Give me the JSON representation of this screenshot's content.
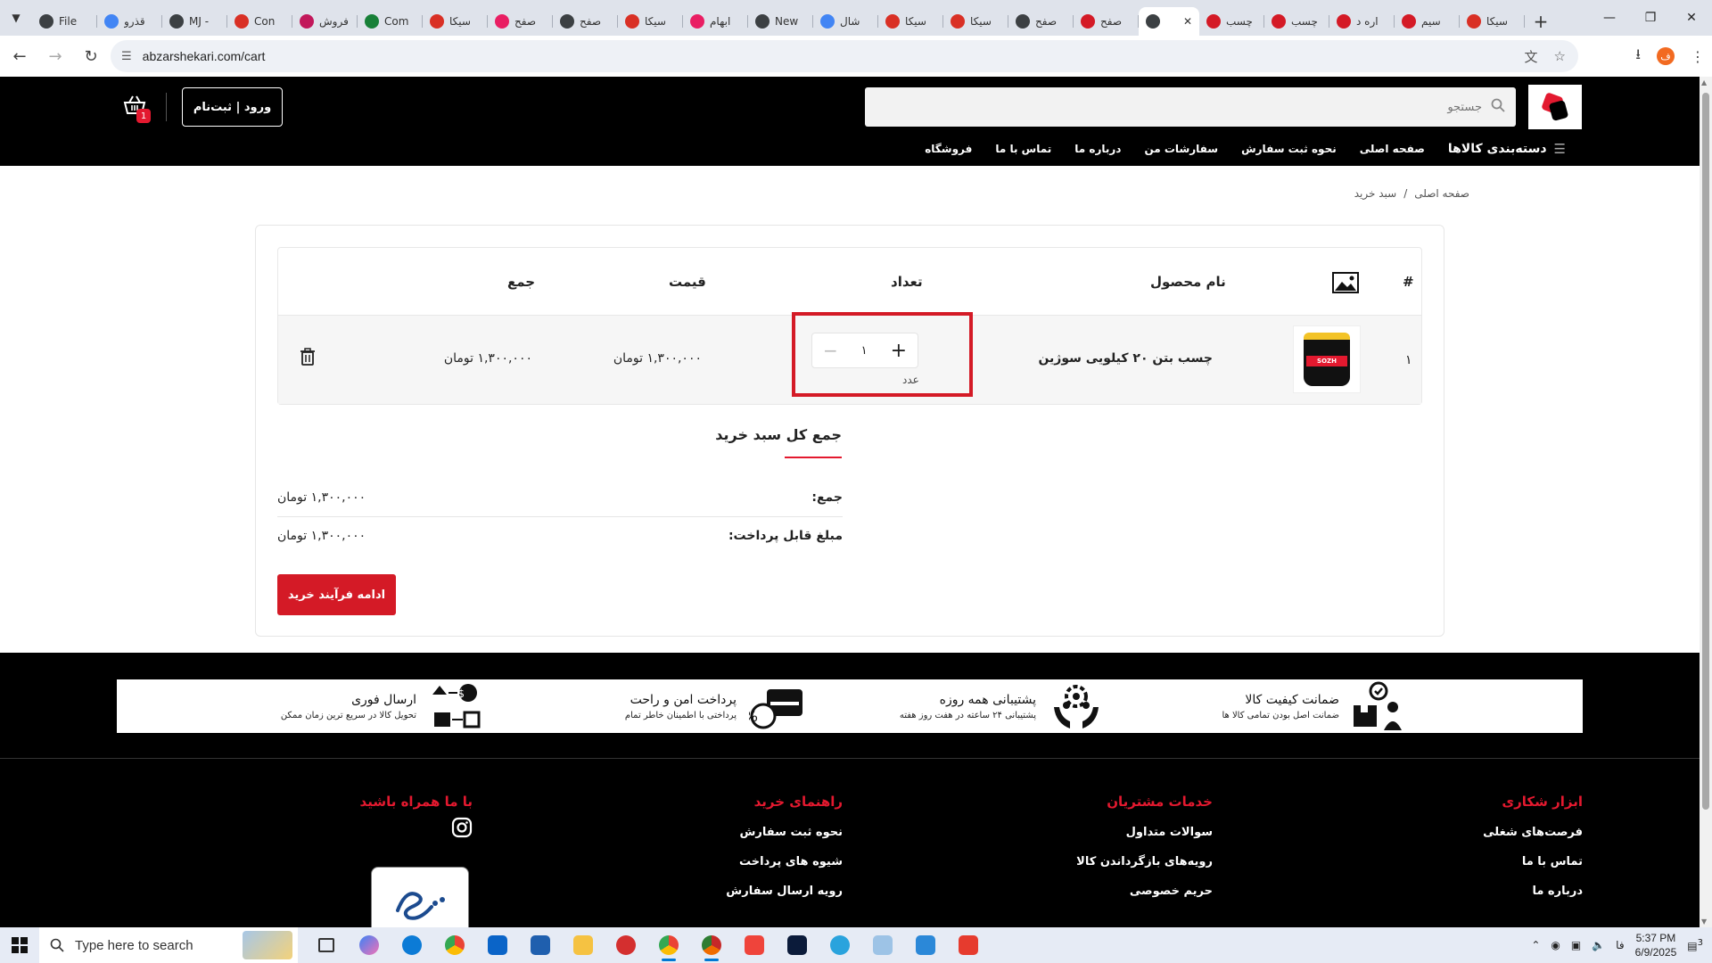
{
  "browser": {
    "tabs": [
      {
        "label": "File",
        "color": "#3c4043"
      },
      {
        "label": "قذرو",
        "color": "#4285f4"
      },
      {
        "label": "MJ -",
        "color": "#3c4043"
      },
      {
        "label": "Con",
        "color": "#d93025"
      },
      {
        "label": "فروش",
        "color": "#c2185b"
      },
      {
        "label": "Com",
        "color": "#188038"
      },
      {
        "label": "سیکا",
        "color": "#d93025"
      },
      {
        "label": "صفح",
        "color": "#e91e63"
      },
      {
        "label": "صفح",
        "color": "#3c4043"
      },
      {
        "label": "سیکا",
        "color": "#d93025"
      },
      {
        "label": "ابهام",
        "color": "#e91e63"
      },
      {
        "label": "New",
        "color": "#3c4043"
      },
      {
        "label": "شال",
        "color": "#4285f4"
      },
      {
        "label": "سیکا",
        "color": "#d93025"
      },
      {
        "label": "سیکا",
        "color": "#d93025"
      },
      {
        "label": "صفح",
        "color": "#3c4043"
      },
      {
        "label": "صفح",
        "color": "#d41a26"
      },
      {
        "label": "",
        "color": "#3c4043",
        "active": true
      },
      {
        "label": "چسب",
        "color": "#d41a26"
      },
      {
        "label": "چسب",
        "color": "#d41a26"
      },
      {
        "label": "اره د",
        "color": "#d41a26"
      },
      {
        "label": "سیم",
        "color": "#d41a26"
      },
      {
        "label": "سیکا",
        "color": "#d93025"
      }
    ],
    "url": "abzarshekari.com/cart",
    "profile_initial": "ف"
  },
  "header": {
    "search_placeholder": "جستجو",
    "login_label": "ورود | ثبت‌نام",
    "cart_count": "1",
    "menu": {
      "categories": "دسته‌بندی کالاها",
      "home": "صفحه اصلی",
      "how_to_order": "نحوه ثبت سفارش",
      "my_orders": "سفارشات من",
      "about": "درباره ما",
      "contact": "تماس با ما",
      "shop": "فروشگاه"
    }
  },
  "breadcrumb": {
    "home": "صفحه اصلی",
    "sep": "/",
    "current": "سبد خرید"
  },
  "cart": {
    "headers": {
      "index": "#",
      "product": "نام محصول",
      "qty": "تعداد",
      "price": "قیمت",
      "total": "جمع"
    },
    "rows": [
      {
        "index": "۱",
        "thumb_label": "SOZH",
        "name": "چسب بتن ۲۰ کیلویی سوژین",
        "qty": "۱",
        "unit": "عدد",
        "price": "۱,۳۰۰,۰۰۰ تومان",
        "total": "۱,۳۰۰,۰۰۰ تومان"
      }
    ]
  },
  "totals": {
    "title": "جمع کل سبد خرید",
    "subtotal_label": "جمع:",
    "subtotal_value": "۱,۳۰۰,۰۰۰ تومان",
    "payable_label": "مبلغ قابل پرداخت:",
    "payable_value": "۱,۳۰۰,۰۰۰ تومان",
    "checkout_label": "ادامه فرآیند خرید"
  },
  "features": [
    {
      "title": "ضمانت کیفیت کالا",
      "subtitle": "ضمانت اصل بودن تمامی کالا ها",
      "icon": "quality-box-icon"
    },
    {
      "title": "پشتیبانی همه روزه",
      "subtitle": "پشتیبانی ۲۴ ساعته در هفت روز هفته",
      "icon": "support-hands-icon"
    },
    {
      "title": "پرداخت امن و راحت",
      "subtitle": "پرداختی با اطمینان خاطر تمام",
      "icon": "secure-payment-icon"
    },
    {
      "title": "ارسال فوری",
      "subtitle": "تحویل کالا در سریع ترین زمان ممکن",
      "icon": "fast-delivery-icon"
    }
  ],
  "footer": {
    "col1": {
      "title": "ابزار شکاری",
      "links": [
        "فرصت‌های شغلی",
        "تماس با ما",
        "درباره ما"
      ]
    },
    "col2": {
      "title": "خدمات مشتریان",
      "links": [
        "سوالات متداول",
        "رویه‌های بازگرداندن کالا",
        "حریم خصوصی"
      ]
    },
    "col3": {
      "title": "راهنمای خرید",
      "links": [
        "نحوه ثبت سفارش",
        "شیوه های پرداخت",
        "رویه ارسال سفارش"
      ]
    },
    "col4": {
      "title": "با ما همراه باشید"
    }
  },
  "taskbar": {
    "search_placeholder": "Type here to search",
    "lang": "فا",
    "time": "5:37 PM",
    "date": "6/9/2025",
    "notification_count": "3"
  },
  "colors": {
    "brand_red": "#d41a26",
    "header_black": "#000000"
  }
}
